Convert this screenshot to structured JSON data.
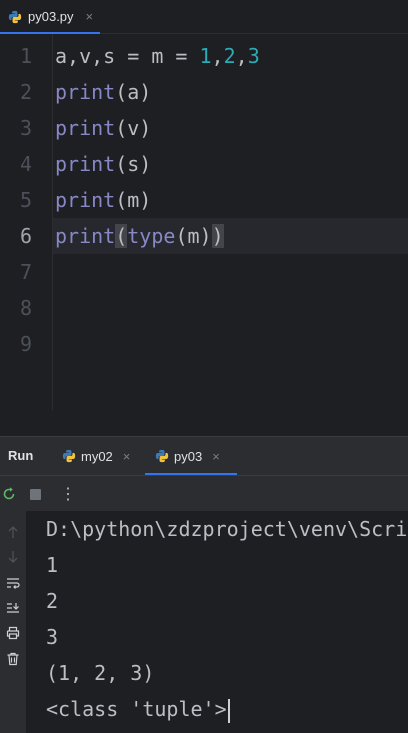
{
  "editor_tab": {
    "filename": "py03.py",
    "close": "×"
  },
  "gutter": {
    "lines": [
      "1",
      "2",
      "3",
      "4",
      "5",
      "6",
      "7",
      "8",
      "9"
    ]
  },
  "code": {
    "line1": {
      "vars": "a,v,s = m = ",
      "n1": "1",
      "c1": ",",
      "n2": "2",
      "c2": ",",
      "n3": "3"
    },
    "line2": {
      "fn": "print",
      "args": "(a)"
    },
    "line3": {
      "fn": "print",
      "args": "(v)"
    },
    "line4": {
      "fn": "print",
      "args": "(s)"
    },
    "line5": {
      "fn": "print",
      "args": "(m)"
    },
    "line6": {
      "fn": "print",
      "open": "(",
      "inner_fn": "type",
      "inner_args": "(m)",
      "close": ")"
    }
  },
  "run_panel": {
    "title": "Run",
    "tabs": [
      {
        "label": "my02",
        "close": "×"
      },
      {
        "label": "py03",
        "close": "×"
      }
    ],
    "more": "⋮"
  },
  "console": {
    "lines": [
      "D:\\python\\zdzproject\\venv\\Scripts\\python.exe",
      "1",
      "2",
      "3",
      "(1, 2, 3)",
      "<class 'tuple'>"
    ]
  },
  "colors": {
    "accent": "#3574f0",
    "keyword": "#8888c6",
    "number": "#2aacb8",
    "rerun": "#5fb865"
  },
  "icons": [
    "python-file-icon",
    "rerun-icon",
    "stop-icon",
    "more-icon",
    "up-arrow-icon",
    "down-arrow-icon",
    "soft-wrap-icon",
    "scroll-to-end-icon",
    "print-icon",
    "trash-icon"
  ]
}
